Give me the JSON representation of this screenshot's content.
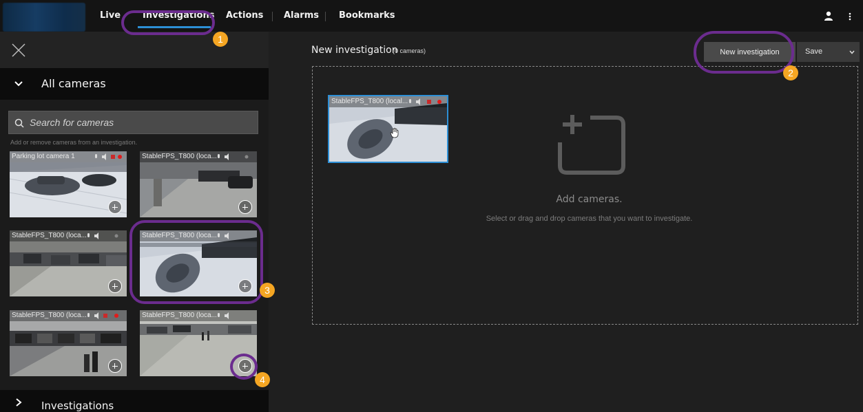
{
  "nav": {
    "tabs": [
      {
        "label": "Live"
      },
      {
        "label": "Investigations"
      },
      {
        "label": "Actions"
      },
      {
        "label": "Alarms"
      },
      {
        "label": "Bookmarks"
      }
    ],
    "active_tab": "Investigations",
    "accent_color": "#2d8fd6"
  },
  "left_panel": {
    "all_cameras_label": "All cameras",
    "search_placeholder": "Search for cameras",
    "hint": "Add or remove cameras from an investigation.",
    "cameras": [
      {
        "title": "Parking lot camera 1"
      },
      {
        "title": "StableFPS_T800 (loca..."
      },
      {
        "title": "StableFPS_T800 (loca..."
      },
      {
        "title": "StableFPS_T800 (loca..."
      },
      {
        "title": "StableFPS_T800 (loca..."
      },
      {
        "title": "StableFPS_T800 (loca..."
      }
    ],
    "investigations_label": "Investigations"
  },
  "main": {
    "title": "New investigation",
    "camera_count": "(0 cameras)",
    "new_investigation_button": "New investigation",
    "save_button": "Save",
    "added_camera_title": "StableFPS_T800 (local...",
    "empty_title": "Add cameras.",
    "empty_subtitle": "Select or drag and drop cameras that you want to investigate."
  },
  "annotations": {
    "badges": [
      "1",
      "2",
      "3",
      "4"
    ],
    "ring_color": "#6b2c8e",
    "badge_color": "#f5a623"
  }
}
